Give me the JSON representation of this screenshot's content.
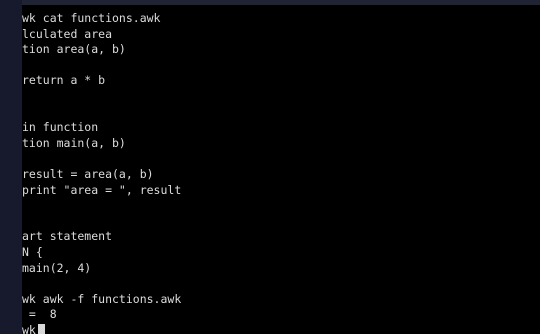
{
  "terminal": {
    "lines": [
      "wk cat functions.awk",
      "lculated area",
      "tion area(a, b)",
      "",
      "return a * b",
      "",
      "",
      "in function",
      "tion main(a, b)",
      "",
      "result = area(a, b)",
      "print \"area = \", result",
      "",
      "",
      "art statement",
      "N {",
      "main(2, 4)",
      "",
      "wk awk -f functions.awk",
      " =  8",
      "wk"
    ]
  },
  "colors": {
    "background": "#000000",
    "text": "#dcdcdc",
    "window_edge": "#171a2c"
  }
}
